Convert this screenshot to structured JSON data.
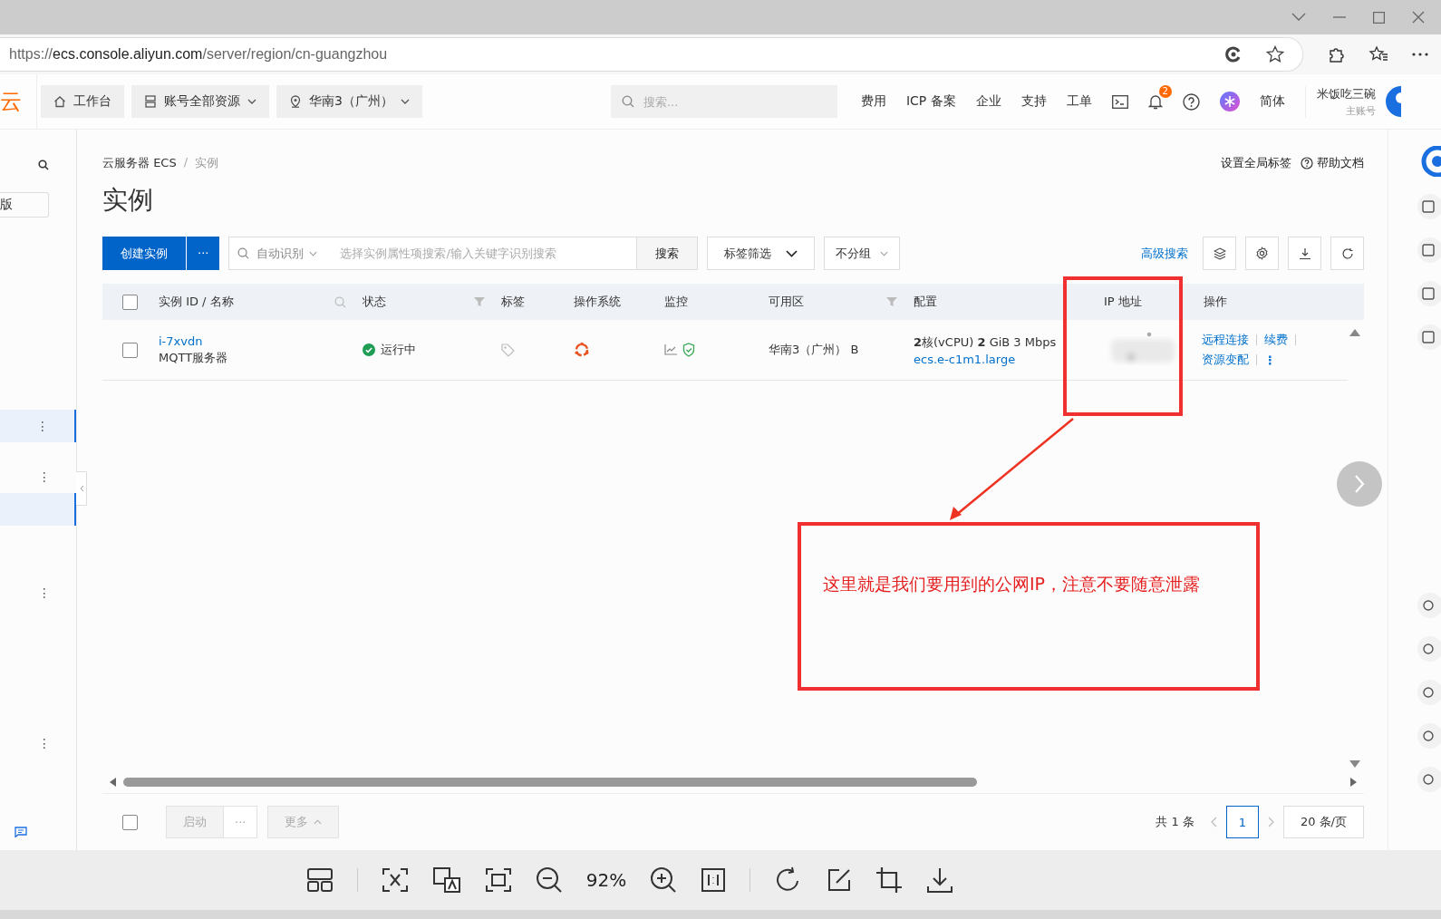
{
  "browser": {
    "url_scheme": "https://",
    "url_host": "ecs.console.aliyun.com",
    "url_path": "/server/region/cn-guangzhou"
  },
  "header": {
    "logo": "云",
    "nav_buttons": [
      {
        "kind": "home",
        "label": "工作台",
        "dropdown": false
      },
      {
        "kind": "resource",
        "label": "账号全部资源",
        "dropdown": true
      },
      {
        "kind": "region",
        "label": "华南3（广州）",
        "dropdown": true
      }
    ],
    "search": {
      "placeholder": "搜索..."
    },
    "links": [
      "费用",
      "ICP 备案",
      "企业",
      "支持",
      "工单"
    ],
    "notification_count": "2",
    "language": "简体",
    "user_name": "米饭吃三碗",
    "user_role": "主账号"
  },
  "sidebar": {
    "edition": "版",
    "items": [
      {
        "selected": true,
        "more": "⋮"
      },
      {
        "selected": false,
        "more": "⋮"
      },
      {
        "selected": true
      },
      {
        "selected": false,
        "more": "⋮"
      },
      {
        "selected": false,
        "more": "⋮"
      }
    ]
  },
  "page": {
    "breadcrumb": [
      "云服务器 ECS",
      "实例"
    ],
    "breadcrumb_separator": "/",
    "title": "实例",
    "header_links": [
      {
        "kind": "text",
        "label": "设置全局标签"
      },
      {
        "kind": "help",
        "label": "帮助文档"
      }
    ],
    "create_button": "创建实例",
    "create_more": "···",
    "search": {
      "mode": "自动识别",
      "placeholder": "选择实例属性项搜索/输入关键字识别搜索",
      "button": "搜索"
    },
    "tag_filter": "标签筛选",
    "group": "不分组",
    "advanced_search": "高级搜索"
  },
  "table": {
    "columns": [
      {
        "label": "实例 ID / 名称",
        "kind": "searchable"
      },
      {
        "label": "状态",
        "kind": "filterable"
      },
      {
        "label": "标签",
        "kind": "plain"
      },
      {
        "label": "操作系统",
        "kind": "plain"
      },
      {
        "label": "监控",
        "kind": "plain"
      },
      {
        "label": "可用区",
        "kind": "filterable"
      },
      {
        "label": "配置",
        "kind": "plain"
      },
      {
        "label": "IP 地址",
        "kind": "plain"
      },
      {
        "label": "操作",
        "kind": "plain"
      }
    ],
    "header_checked": false,
    "rows": [
      {
        "checked": false,
        "id": "i-7xvdn",
        "name": "MQTT服务器",
        "status": "运行中",
        "running": true,
        "zone": "华南3（广州） B",
        "config": "**2**核(vCPU)  **2** GiB 3 Mbps",
        "instance_type": "ecs.e-c1m1.large",
        "actions": [
          "远程连接",
          "续费",
          "资源变配"
        ],
        "more": "⋮"
      }
    ]
  },
  "footer": {
    "checked": false,
    "buttons": [
      {
        "label": "启动",
        "disabled": true,
        "caret": false
      },
      {
        "label": "···",
        "disabled": true,
        "caret": false
      },
      {
        "label": "更多",
        "disabled": true,
        "caret": true
      }
    ],
    "pagination": {
      "total": "共 1 条",
      "page": "1",
      "page_size": "20 条/页"
    }
  },
  "annotation": {
    "text": "这里就是我们要用到的公网IP，注意不要随意泄露"
  },
  "viewer": {
    "zoom": "92%"
  }
}
